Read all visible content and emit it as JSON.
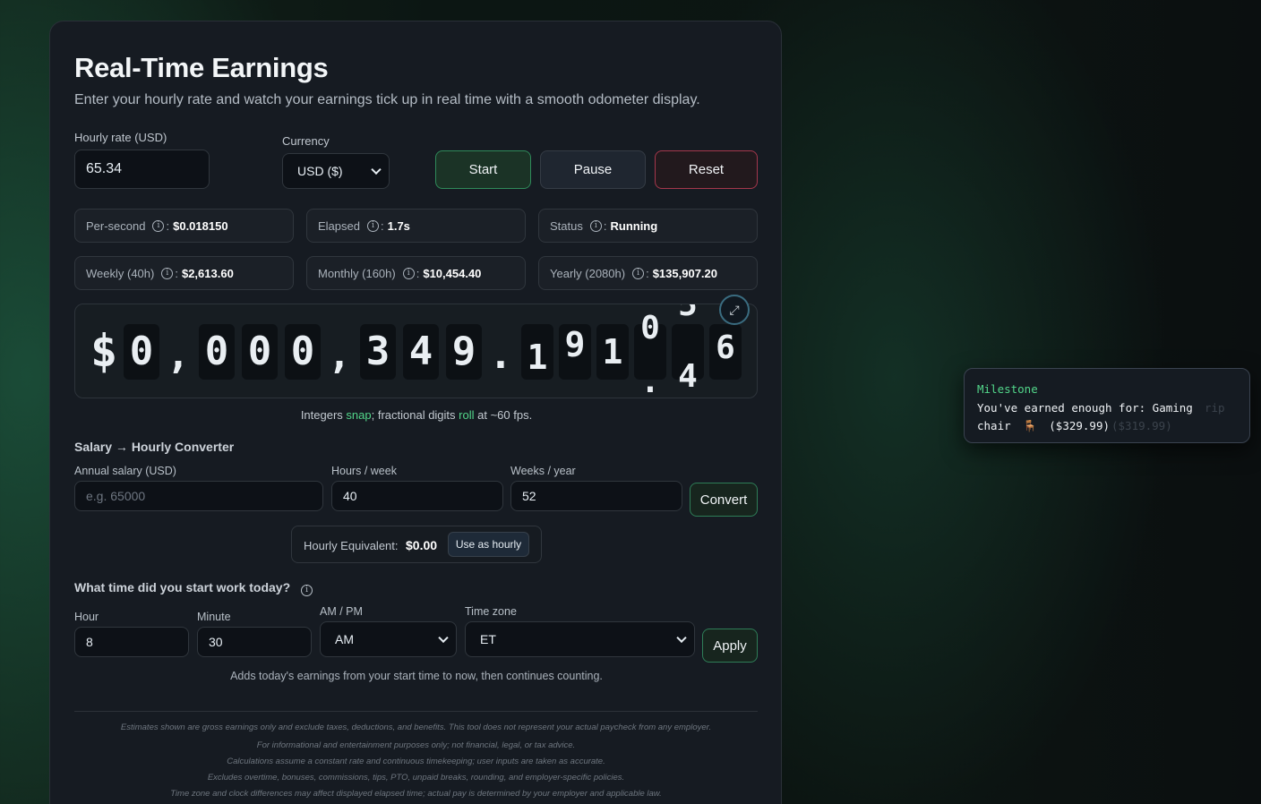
{
  "header": {
    "title": "Real-Time Earnings",
    "subtitle": "Enter your hourly rate and watch your earnings tick up in real time with a smooth odometer display."
  },
  "controls": {
    "hourly_label": "Hourly rate (USD)",
    "hourly_value": "65.34",
    "currency_label": "Currency",
    "currency_value": "USD ($)",
    "start_label": "Start",
    "pause_label": "Pause",
    "reset_label": "Reset"
  },
  "stats": {
    "per_second_label": "Per-second",
    "per_second_value": "$0.018150",
    "elapsed_label": "Elapsed",
    "elapsed_value": "1.7s",
    "status_label": "Status",
    "status_value": "Running",
    "weekly_label": "Weekly (40h)",
    "weekly_value": "$2,613.60",
    "monthly_label": "Monthly (160h)",
    "monthly_value": "$10,454.40",
    "yearly_label": "Yearly (2080h)",
    "yearly_value": "$135,907.20"
  },
  "odometer": {
    "currency_symbol": "$",
    "digits": [
      "0",
      ",",
      "0",
      "0",
      "0",
      ",",
      "3",
      "4",
      "9",
      ".",
      "1",
      "9",
      "1"
    ],
    "rolling_a_top": "0",
    "rolling_a_bottom": ".",
    "rolling_b_top": "5",
    "rolling_b_bottom": "4",
    "last_digit": "6",
    "note_prefix": "Integers ",
    "note_snap": "snap",
    "note_mid": "; fractional digits ",
    "note_roll": "roll",
    "note_suffix": " at ~60 fps."
  },
  "converter": {
    "heading": "Salary → Hourly Converter",
    "annual_label": "Annual salary (USD)",
    "annual_placeholder": "e.g. 65000",
    "hours_label": "Hours / week",
    "hours_value": "40",
    "weeks_label": "Weeks / year",
    "weeks_value": "52",
    "convert_label": "Convert",
    "equiv_label": "Hourly Equivalent:",
    "equiv_value": "$0.00",
    "use_label": "Use as hourly"
  },
  "start_time": {
    "heading": "What time did you start work today?",
    "hour_label": "Hour",
    "hour_value": "8",
    "minute_label": "Minute",
    "minute_value": "30",
    "ampm_label": "AM / PM",
    "ampm_value": "AM",
    "tz_label": "Time zone",
    "tz_value": "ET",
    "apply_label": "Apply",
    "note": "Adds today's earnings from your start time to now, then continues counting."
  },
  "disclaimer": [
    "Estimates shown are gross earnings only and exclude taxes, deductions, and benefits. This tool does not represent your actual paycheck from any employer.",
    "For informational and entertainment purposes only; not financial, legal, or tax advice.",
    "Calculations assume a constant rate and continuous timekeeping; user inputs are taken as accurate.",
    "Excludes overtime, bonuses, commissions, tips, PTO, unpaid breaks, rounding, and employer-specific policies.",
    "Time zone and clock differences may affect displayed elapsed time; actual pay is determined by your employer and applicable law."
  ],
  "toast": {
    "title": "Milestone",
    "line1": "You've earned enough for: Gaming",
    "line2": "chair",
    "line2_price": "($329.99)",
    "ghost1": "rip",
    "ghost2": "($319.99)"
  },
  "icons": {
    "info": "info-icon",
    "expand": "expand-icon",
    "chair": "chair-icon"
  }
}
